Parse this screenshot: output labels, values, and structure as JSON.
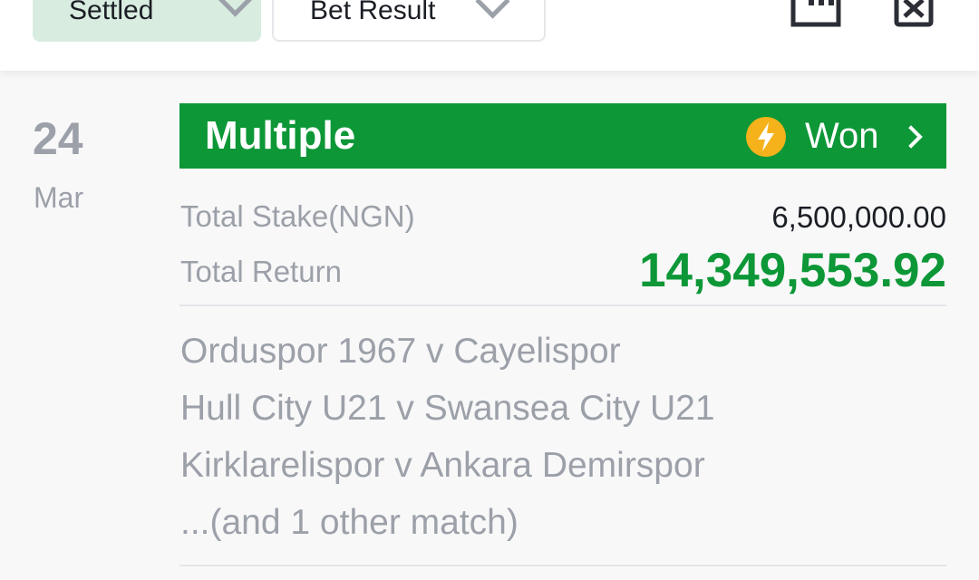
{
  "filters": {
    "settled_label": "Settled",
    "result_label": "Bet Result"
  },
  "icons": {
    "calendar": "calendar-icon",
    "delete": "delete-icon",
    "bolt": "lightning-bolt-icon",
    "chevron": "chevron-right-icon"
  },
  "bet": {
    "day": "24",
    "month": "Mar",
    "type": "Multiple",
    "status": "Won",
    "stake_label": "Total Stake(NGN)",
    "stake_value": "6,500,000.00",
    "return_label": "Total Return",
    "return_value": "14,349,553.92",
    "matches": [
      "Orduspor 1967 v Cayelispor",
      "Hull City U21 v Swansea City U21",
      "Kirklarelispor v Ankara Demirspor",
      "...(and 1 other match)"
    ]
  },
  "colors": {
    "accent_green": "#0d9737",
    "settled_bg": "#d8ece0",
    "bolt_badge": "#f5b21b",
    "muted_text": "#9ca0a8"
  }
}
